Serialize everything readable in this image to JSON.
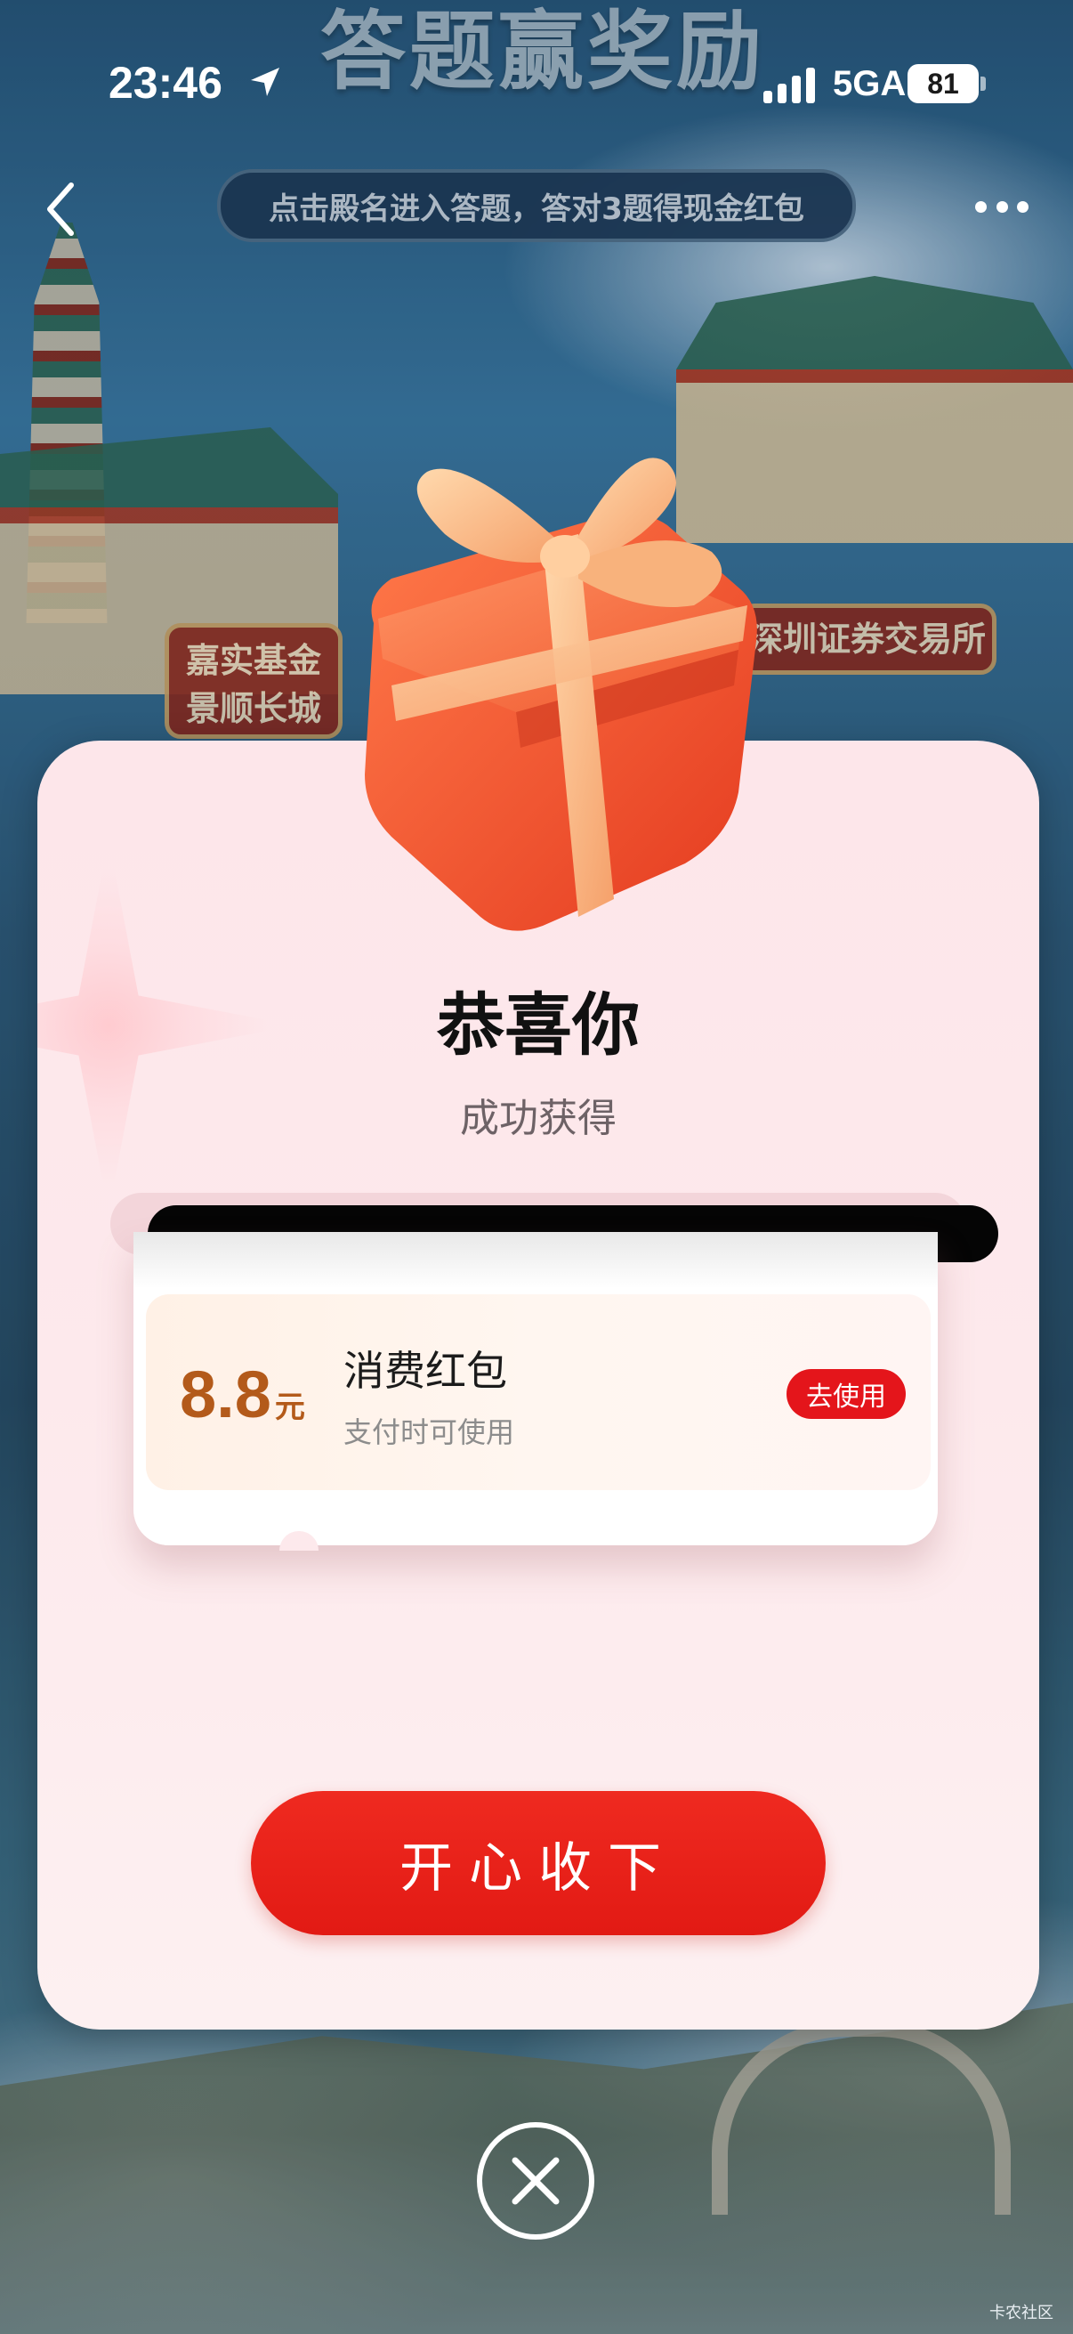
{
  "status_bar": {
    "time": "23:46",
    "network": "5GA",
    "battery": "81"
  },
  "background": {
    "title": "答题赢奖励",
    "banner": "点击殿名进入答题，答对3题得现金红包",
    "left_label_line1": "嘉实基金",
    "left_label_line2": "景顺长城",
    "right_label": "深圳证券交易所"
  },
  "modal": {
    "title": "恭喜你",
    "subtitle": "成功获得",
    "coupon": {
      "amount": "8.8",
      "unit": "元",
      "name": "消费红包",
      "description": "支付时可使用",
      "use_label": "去使用"
    },
    "confirm_label": "开心收下"
  },
  "watermark": "卡农社区",
  "colors": {
    "accent_red": "#e4151b",
    "amount_brown": "#b35a1a"
  }
}
